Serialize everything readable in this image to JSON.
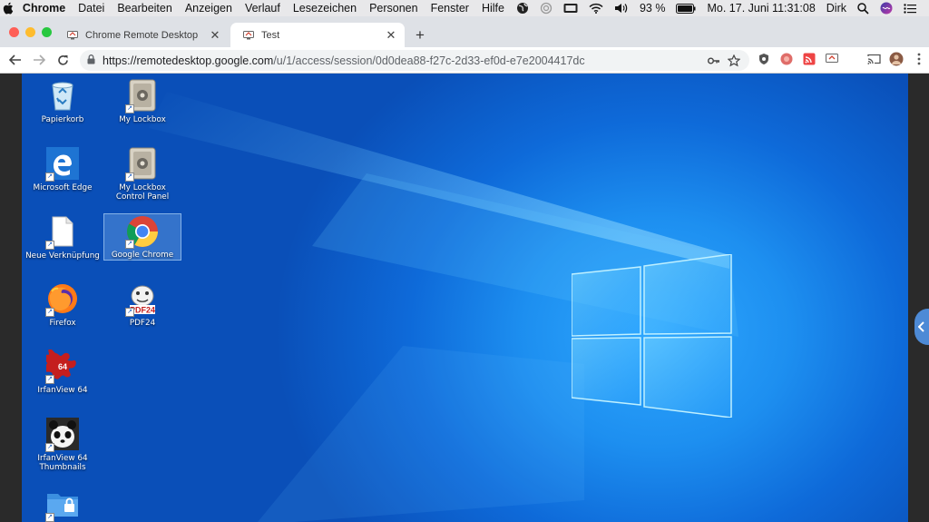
{
  "menubar": {
    "app_name": "Chrome",
    "items": [
      "Datei",
      "Bearbeiten",
      "Anzeigen",
      "Verlauf",
      "Lesezeichen",
      "Personen",
      "Fenster",
      "Hilfe"
    ],
    "battery": "93 %",
    "datetime": "Mo. 17. Juni  11:31:08",
    "user": "Dirk"
  },
  "tabs": [
    {
      "label": "Chrome Remote Desktop"
    },
    {
      "label": "Test"
    }
  ],
  "toolbar": {
    "url_host": "https://remotedesktop.google.com",
    "url_path": "/u/1/access/session/0d0dea88-f27c-2d33-ef0d-e7e2004417dc"
  },
  "desktop": {
    "icons": [
      {
        "label": "Papierkorb",
        "icon": "recycle-bin-icon"
      },
      {
        "label": "My Lockbox",
        "icon": "lockbox-icon"
      },
      {
        "label": "Microsoft Edge",
        "icon": "edge-icon"
      },
      {
        "label": "My Lockbox Control Panel",
        "icon": "lockbox-icon"
      },
      {
        "label": "Neue Verknüpfung",
        "icon": "blank-file-icon"
      },
      {
        "label": "Google Chrome",
        "icon": "chrome-icon"
      },
      {
        "label": "Firefox",
        "icon": "firefox-icon"
      },
      {
        "label": "PDF24",
        "icon": "pdf24-icon"
      },
      {
        "label": "IrfanView 64",
        "icon": "irfanview-icon"
      },
      {
        "label": "IrfanView 64 Thumbnails",
        "icon": "irfanview-thumbnails-icon"
      }
    ]
  },
  "colors": {
    "desktop_blue": "#0e6ad9",
    "traffic_red": "#fe5f57",
    "traffic_yellow": "#febc2e",
    "traffic_green": "#28c840"
  }
}
